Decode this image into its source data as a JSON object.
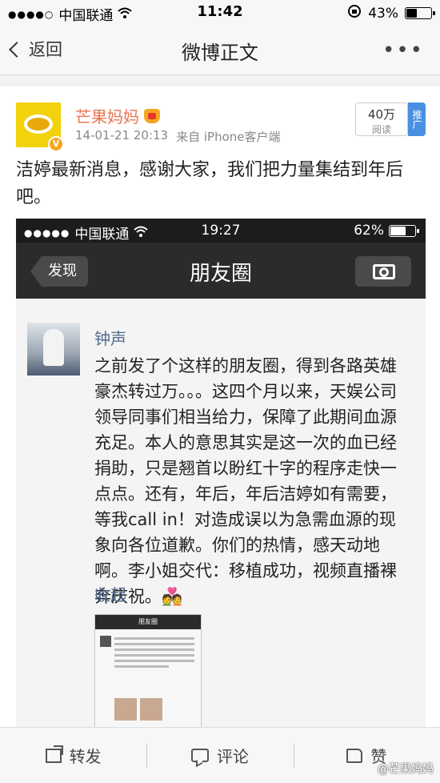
{
  "status_bar": {
    "signal": "●●●●○",
    "carrier": "中国联通",
    "time": "11:42",
    "battery": "43%",
    "battery_level": 0.43
  },
  "nav": {
    "back_label": "返回",
    "title": "微博正文",
    "more_label": "•••"
  },
  "post": {
    "author": "芒果妈妈",
    "timestamp": "14-01-21 20:13",
    "source": "来自 iPhone客户端",
    "reads_count": "40万",
    "reads_label": "阅读",
    "promote_label": "推广",
    "text": "洁婷最新消息，感谢大家，我们把力量集结到年后吧。"
  },
  "embedded_screenshot": {
    "status_bar": {
      "signal": "●●●●●",
      "carrier": "中国联通",
      "time": "19:27",
      "battery": "62%",
      "battery_level": 0.62
    },
    "back_label": "发现",
    "title": "朋友圈",
    "author": "钟声",
    "body": "之前发了个这样的朋友圈，得到各路英雄豪杰转过万。。。这四个月以来，天娱公司领导同事们相当给力，保障了此期间血源充足。本人的意思其实是这一次的血已经捐助，只是翘首以盼红十字的程序走快一点点。还有，年后，年后洁婷如有需要，等我call in！对造成误以为急需血源的现象向各位道歉。你们的热情，感天动地啊。李小姐交代：移植成功，视频直播裸奔庆祝。💑",
    "collapse_label": "收起",
    "thumb_title": "朋友圈"
  },
  "footer": {
    "repost_label": "转发",
    "comment_label": "评论",
    "like_label": "赞"
  },
  "watermark": "@芒果妈妈"
}
